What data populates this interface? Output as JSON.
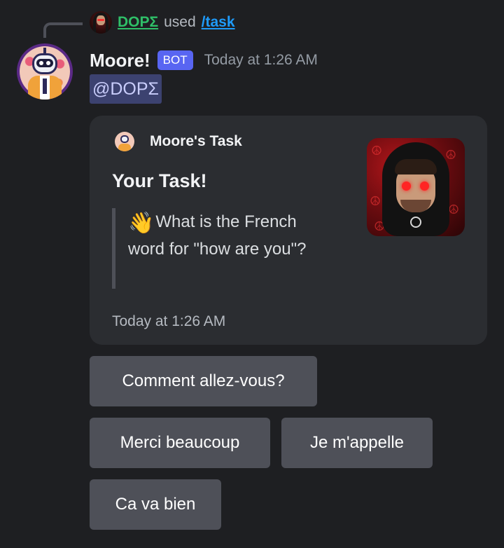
{
  "command": {
    "user": "DOPΣ",
    "used_text": "used",
    "command": "/task"
  },
  "message": {
    "author": "Moore!",
    "badge": "BOT",
    "timestamp": "Today at 1:26 AM",
    "mention": "@DOPΣ"
  },
  "embed": {
    "author_name": "Moore's Task",
    "title": "Your Task!",
    "quote_emoji": "👋",
    "quote_text": "What is the French word for \"how are you\"?",
    "footer": "Today at 1:26 AM"
  },
  "buttons": [
    "Comment allez-vous?",
    "Merci beaucoup",
    "Je m'appelle",
    "Ca va bien"
  ],
  "colors": {
    "background": "#1e1f22",
    "embed": "#2b2d31",
    "button": "#4e5058",
    "bot_badge": "#5865f2",
    "username_green": "#2fbf68",
    "command_blue": "#1e9bfa",
    "mention_bg": "#3c4270"
  }
}
